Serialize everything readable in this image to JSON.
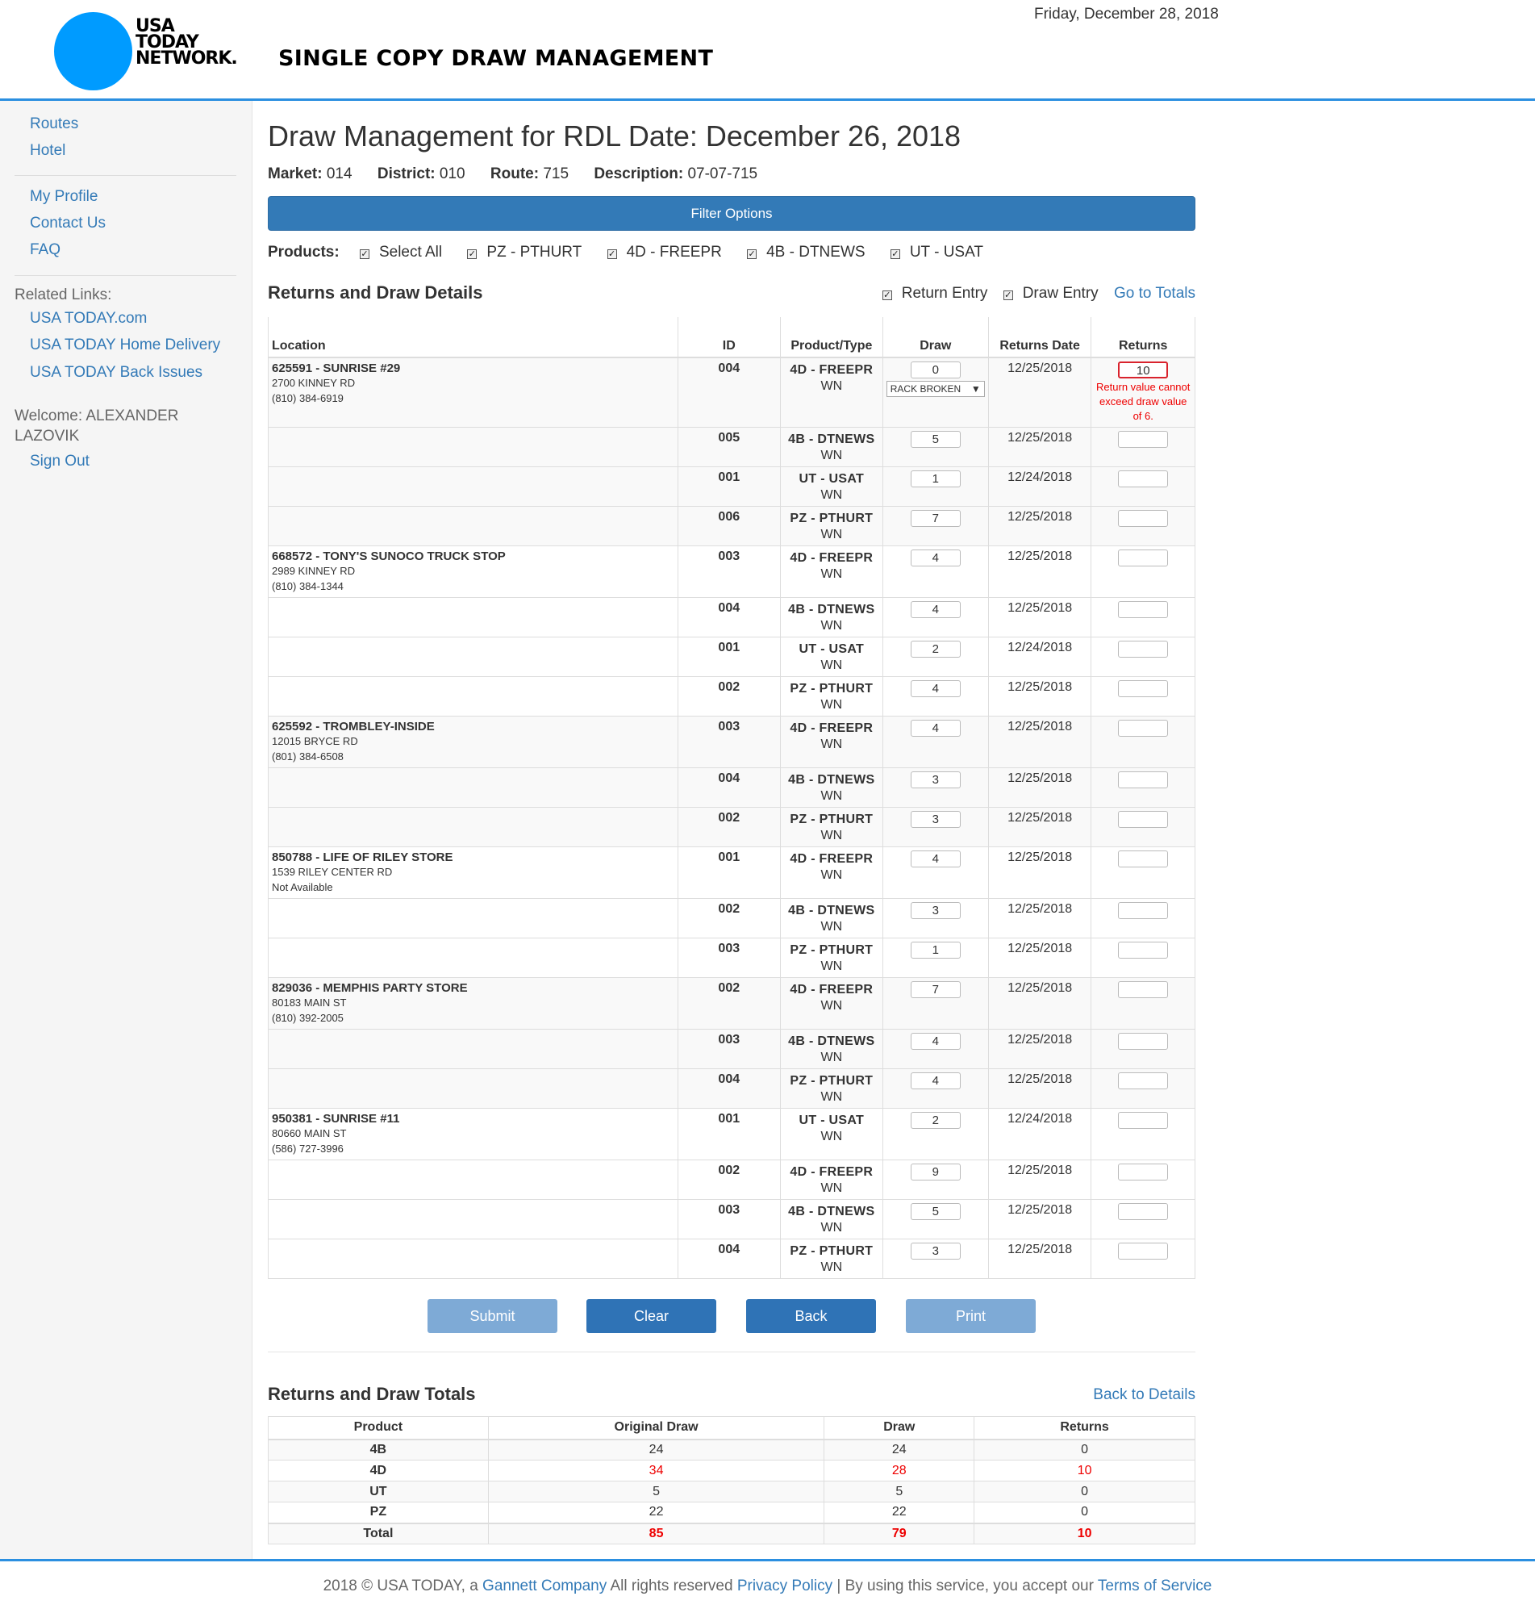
{
  "header": {
    "logo_lines": [
      "USA",
      "TODAY",
      "NETWORK."
    ],
    "app_title": "SINGLE COPY DRAW MANAGEMENT",
    "date": "Friday, December 28, 2018"
  },
  "sidebar": {
    "nav": [
      "Routes",
      "Hotel"
    ],
    "account": [
      "My Profile",
      "Contact Us",
      "FAQ"
    ],
    "related_heading": "Related Links:",
    "related": [
      "USA TODAY.com",
      "USA TODAY Home Delivery",
      "USA TODAY Back Issues"
    ],
    "welcome_line1": "Welcome: ALEXANDER",
    "welcome_line2": "LAZOVIK",
    "sign_out": "Sign Out"
  },
  "main": {
    "title": "Draw Management for RDL Date: December 26, 2018",
    "meta": [
      {
        "label": "Market:",
        "value": "014"
      },
      {
        "label": "District:",
        "value": "010"
      },
      {
        "label": "Route:",
        "value": "715"
      },
      {
        "label": "Description:",
        "value": "07-07-715"
      }
    ],
    "filter_button": "Filter Options",
    "products_label": "Products:",
    "products": [
      "Select All",
      "PZ - PTHURT",
      "4D - FREEPR",
      "4B - DTNEWS",
      "UT - USAT"
    ],
    "details_title": "Returns and Draw Details",
    "return_entry": "Return Entry",
    "draw_entry": "Draw Entry",
    "go_to_totals": "Go to Totals",
    "columns": [
      "Location",
      "ID",
      "Product/Type",
      "Draw",
      "Returns Date",
      "Returns"
    ],
    "rows": [
      {
        "loc": "625591 - SUNRISE #29",
        "addr": "2700 KINNEY RD",
        "phone": "(810) 384-6919",
        "id": "004",
        "product": "4D - FREEPR",
        "type": "WN",
        "draw": "0",
        "select": "RACK BROKEN",
        "rdate": "12/25/2018",
        "returns": "10",
        "error": "Return value cannot exceed draw value of 6."
      },
      {
        "id": "005",
        "product": "4B - DTNEWS",
        "type": "WN",
        "draw": "5",
        "rdate": "12/25/2018",
        "returns": ""
      },
      {
        "id": "001",
        "product": "UT - USAT",
        "type": "WN",
        "draw": "1",
        "rdate": "12/24/2018",
        "returns": ""
      },
      {
        "id": "006",
        "product": "PZ - PTHURT",
        "type": "WN",
        "draw": "7",
        "rdate": "12/25/2018",
        "returns": ""
      },
      {
        "loc": "668572 - TONY'S SUNOCO TRUCK STOP",
        "addr": "2989 KINNEY RD",
        "phone": "(810) 384-1344",
        "id": "003",
        "product": "4D - FREEPR",
        "type": "WN",
        "draw": "4",
        "rdate": "12/25/2018",
        "returns": ""
      },
      {
        "id": "004",
        "product": "4B - DTNEWS",
        "type": "WN",
        "draw": "4",
        "rdate": "12/25/2018",
        "returns": ""
      },
      {
        "id": "001",
        "product": "UT - USAT",
        "type": "WN",
        "draw": "2",
        "rdate": "12/24/2018",
        "returns": ""
      },
      {
        "id": "002",
        "product": "PZ - PTHURT",
        "type": "WN",
        "draw": "4",
        "rdate": "12/25/2018",
        "returns": ""
      },
      {
        "loc": "625592 - TROMBLEY-INSIDE",
        "addr": "12015 BRYCE RD",
        "phone": "(801) 384-6508",
        "id": "003",
        "product": "4D - FREEPR",
        "type": "WN",
        "draw": "4",
        "rdate": "12/25/2018",
        "returns": ""
      },
      {
        "id": "004",
        "product": "4B - DTNEWS",
        "type": "WN",
        "draw": "3",
        "rdate": "12/25/2018",
        "returns": ""
      },
      {
        "id": "002",
        "product": "PZ - PTHURT",
        "type": "WN",
        "draw": "3",
        "rdate": "12/25/2018",
        "returns": ""
      },
      {
        "loc": "850788 - LIFE OF RILEY STORE",
        "addr": "1539 RILEY CENTER RD",
        "phone": "Not Available",
        "id": "001",
        "product": "4D - FREEPR",
        "type": "WN",
        "draw": "4",
        "rdate": "12/25/2018",
        "returns": ""
      },
      {
        "id": "002",
        "product": "4B - DTNEWS",
        "type": "WN",
        "draw": "3",
        "rdate": "12/25/2018",
        "returns": ""
      },
      {
        "id": "003",
        "product": "PZ - PTHURT",
        "type": "WN",
        "draw": "1",
        "rdate": "12/25/2018",
        "returns": ""
      },
      {
        "loc": "829036 - MEMPHIS PARTY STORE",
        "addr": "80183 MAIN ST",
        "phone": "(810) 392-2005",
        "id": "002",
        "product": "4D - FREEPR",
        "type": "WN",
        "draw": "7",
        "rdate": "12/25/2018",
        "returns": ""
      },
      {
        "id": "003",
        "product": "4B - DTNEWS",
        "type": "WN",
        "draw": "4",
        "rdate": "12/25/2018",
        "returns": ""
      },
      {
        "id": "004",
        "product": "PZ - PTHURT",
        "type": "WN",
        "draw": "4",
        "rdate": "12/25/2018",
        "returns": ""
      },
      {
        "loc": "950381 - SUNRISE #11",
        "addr": "80660 MAIN ST",
        "phone": "(586) 727-3996",
        "id": "001",
        "product": "UT - USAT",
        "type": "WN",
        "draw": "2",
        "rdate": "12/24/2018",
        "returns": ""
      },
      {
        "id": "002",
        "product": "4D - FREEPR",
        "type": "WN",
        "draw": "9",
        "rdate": "12/25/2018",
        "returns": ""
      },
      {
        "id": "003",
        "product": "4B - DTNEWS",
        "type": "WN",
        "draw": "5",
        "rdate": "12/25/2018",
        "returns": ""
      },
      {
        "id": "004",
        "product": "PZ - PTHURT",
        "type": "WN",
        "draw": "3",
        "rdate": "12/25/2018",
        "returns": ""
      }
    ],
    "buttons": [
      {
        "label": "Submit",
        "style": "light"
      },
      {
        "label": "Clear",
        "style": "dark"
      },
      {
        "label": "Back",
        "style": "dark"
      },
      {
        "label": "Print",
        "style": "light"
      }
    ],
    "totals_title": "Returns and Draw Totals",
    "back_to_details": "Back to Details",
    "totals_columns": [
      "Product",
      "Original Draw",
      "Draw",
      "Returns"
    ],
    "totals_rows": [
      {
        "product": "4B",
        "original": "24",
        "draw": "24",
        "returns": "0",
        "red": false
      },
      {
        "product": "4D",
        "original": "34",
        "draw": "28",
        "returns": "10",
        "red": true
      },
      {
        "product": "UT",
        "original": "5",
        "draw": "5",
        "returns": "0",
        "red": false
      },
      {
        "product": "PZ",
        "original": "22",
        "draw": "22",
        "returns": "0",
        "red": false
      }
    ],
    "totals_total": {
      "product": "Total",
      "original": "85",
      "draw": "79",
      "returns": "10"
    }
  },
  "footer": {
    "prefix": "2018 © USA TODAY, a ",
    "company_link": "Gannett Company",
    "middle": " All rights reserved ",
    "privacy_link": "Privacy Policy",
    "after_privacy": " | By using this service, you accept our ",
    "terms_link": "Terms of Service"
  },
  "colors": {
    "accent": "#337ab7",
    "header_rule": "#2b8fe0",
    "error": "#e00000",
    "logo": "#009bff"
  }
}
